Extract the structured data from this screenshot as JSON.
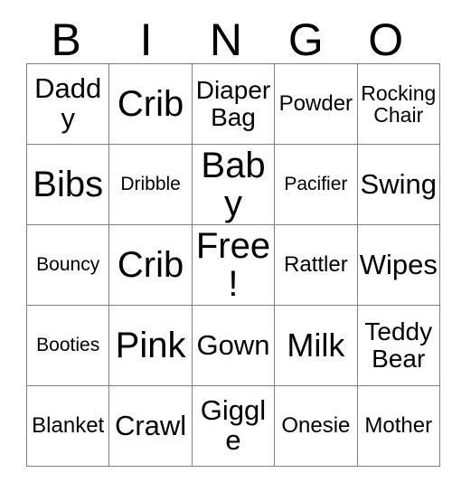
{
  "card": {
    "title": "BINGO",
    "header_letters": [
      "B",
      "I",
      "N",
      "G",
      "O"
    ],
    "colors": {
      "text": "#000000",
      "grid_border": "#808080",
      "background": "#ffffff"
    },
    "free_space": "Free!",
    "grid": [
      [
        {
          "label": "Daddy",
          "size": "fs-l"
        },
        {
          "label": "Crib",
          "size": "fs-xxl"
        },
        {
          "label": "Diaper\nBag",
          "size": "fs-m"
        },
        {
          "label": "Powder",
          "size": "fs-s"
        },
        {
          "label": "Rocking\nChair",
          "size": "fs-xs"
        }
      ],
      [
        {
          "label": "Bibs",
          "size": "fs-xxl"
        },
        {
          "label": "Dribble",
          "size": "fs-xxs"
        },
        {
          "label": "Baby",
          "size": "fs-xxl"
        },
        {
          "label": "Pacifier",
          "size": "fs-xxs"
        },
        {
          "label": "Swing",
          "size": "fs-l"
        }
      ],
      [
        {
          "label": "Bouncy",
          "size": "fs-xxs"
        },
        {
          "label": "Crib",
          "size": "fs-xxl"
        },
        {
          "label": "Free!",
          "size": "fs-xxl"
        },
        {
          "label": "Rattler",
          "size": "fs-s"
        },
        {
          "label": "Wipes",
          "size": "fs-l"
        }
      ],
      [
        {
          "label": "Booties",
          "size": "fs-xxs"
        },
        {
          "label": "Pink",
          "size": "fs-xxl"
        },
        {
          "label": "Gown",
          "size": "fs-l"
        },
        {
          "label": "Milk",
          "size": "fs-xl"
        },
        {
          "label": "Teddy\nBear",
          "size": "fs-m"
        }
      ],
      [
        {
          "label": "Blanket",
          "size": "fs-s"
        },
        {
          "label": "Crawl",
          "size": "fs-l"
        },
        {
          "label": "Giggle",
          "size": "fs-l"
        },
        {
          "label": "Onesie",
          "size": "fs-s"
        },
        {
          "label": "Mother",
          "size": "fs-s"
        }
      ]
    ]
  }
}
